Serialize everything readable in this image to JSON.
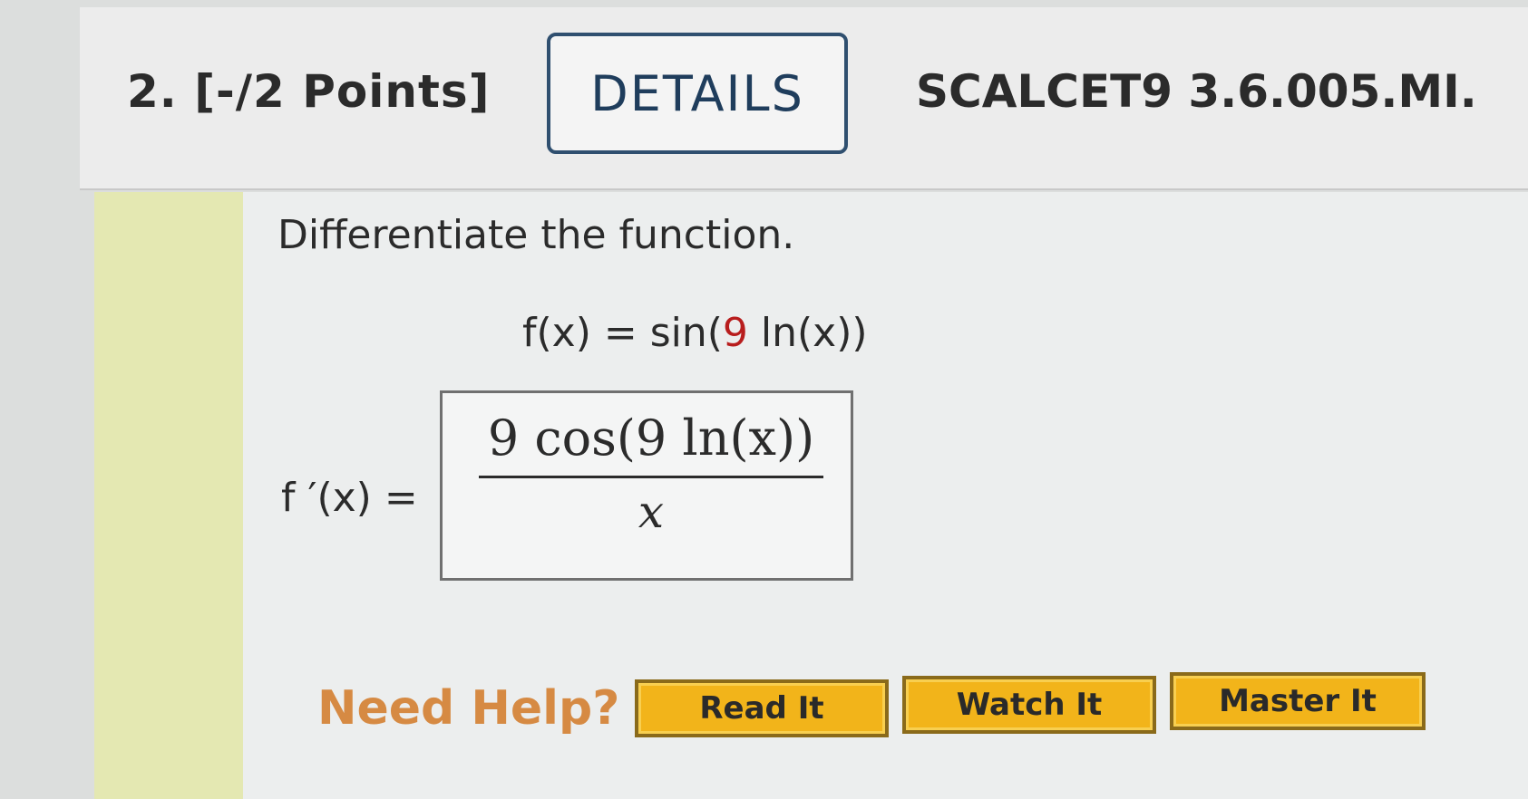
{
  "question": {
    "number_points": "2. [-/2 Points]",
    "details_label": "DETAILS",
    "problem_id": "SCALCET9 3.6.005.MI."
  },
  "problem": {
    "prompt": "Differentiate the function.",
    "function_lhs": "f(x) = sin(",
    "function_coef": "9",
    "function_rhs": " ln(x))",
    "derivative_label": "f ′(x) =",
    "answer_numerator": "9 cos(9 ln(x))",
    "answer_denominator": "x"
  },
  "help": {
    "label": "Need Help?",
    "buttons": [
      "Read It",
      "Watch It",
      "Master It"
    ]
  },
  "colors": {
    "accent_strip": "#e4e8b2",
    "help_label": "#d68a43",
    "help_button": "#f2b41a",
    "details_border": "#2f4f6f",
    "coefficient": "#b81d1d"
  }
}
